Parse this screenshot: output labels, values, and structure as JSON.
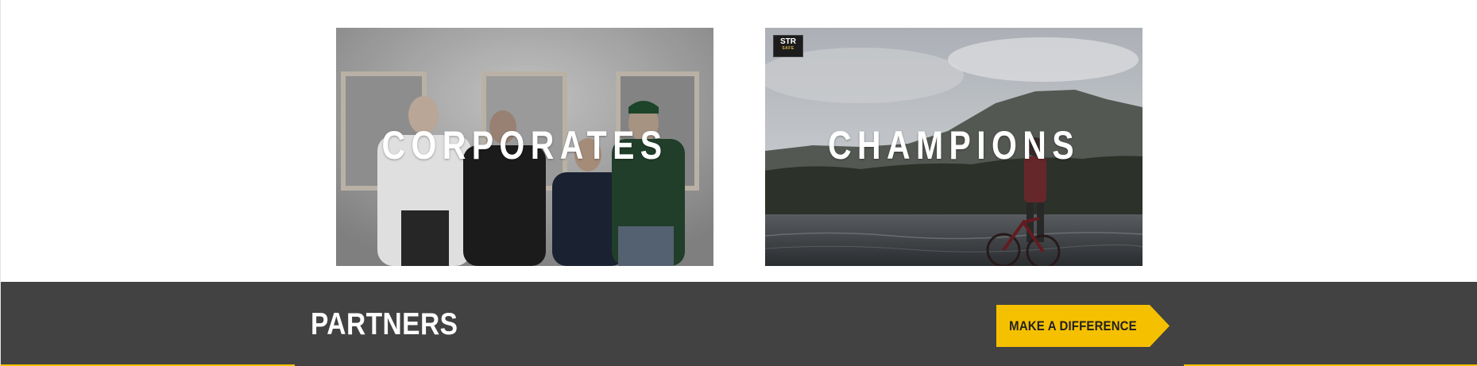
{
  "cards": [
    {
      "title": "CORPORATES"
    },
    {
      "title": "CHAMPIONS",
      "logo": {
        "text": "STR",
        "subtext": "SAFE"
      }
    }
  ],
  "partners": {
    "title": "PARTNERS",
    "cta_label": "MAKE A DIFFERENCE"
  },
  "colors": {
    "bar_background": "#424242",
    "cta_background": "#f5c000",
    "card_title": "#ffffff"
  }
}
